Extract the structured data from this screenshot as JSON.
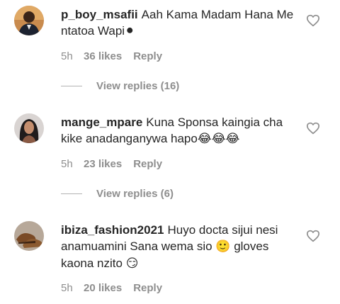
{
  "comments": [
    {
      "username": "p_boy_msafii",
      "text": "Aah Kama Madam Hana Me ntatoa Wapi",
      "emoji": "⚫",
      "time": "5h",
      "likes": "36 likes",
      "reply": "Reply",
      "view_replies": "View replies (16)",
      "avatar_icon": "avatar-photo-man-dark-suit"
    },
    {
      "username": "mange_mpare",
      "text": "Kuna Sponsa kaingia cha kike anadanganywa hapo",
      "emoji": "😂😂😂",
      "time": "5h",
      "likes": "23 likes",
      "reply": "Reply",
      "view_replies": "View replies (6)",
      "avatar_icon": "avatar-photo-woman"
    },
    {
      "username": "ibiza_fashion2021",
      "text": "Huyo docta sijui nesi anamuamini Sana wema sio",
      "emoji_mid": "🙂",
      "text_end": "gloves kaona nzito",
      "emoji": "😏",
      "time": "5h",
      "likes": "20 likes",
      "reply": "Reply",
      "avatar_icon": "avatar-photo-shoes"
    }
  ],
  "colors": {
    "text": "#262626",
    "secondary": "#8e8e8e",
    "line": "#b3b3b3"
  },
  "icons": {
    "like": "heart-outline-icon"
  }
}
